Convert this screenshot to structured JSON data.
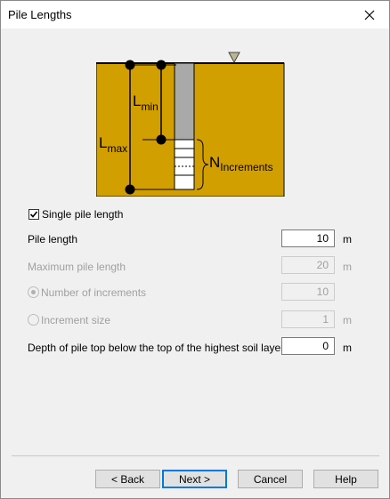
{
  "window": {
    "title": "Pile Lengths"
  },
  "diagram": {
    "l_max_main": "L",
    "l_max_sub": "max",
    "l_min_main": "L",
    "l_min_sub": "min",
    "n_incr_main": "N",
    "n_incr_sub": "Increments",
    "soil_color": "#d29f00"
  },
  "single_pile": {
    "label": "Single pile length",
    "checked": true
  },
  "pile_length": {
    "label": "Pile length",
    "value": "10",
    "unit": "m"
  },
  "max_pile_length": {
    "label": "Maximum pile length",
    "value": "20",
    "unit": "m"
  },
  "number_of_increments": {
    "label": "Number of increments",
    "value": "10",
    "selected": true
  },
  "increment_size": {
    "label": "Increment size",
    "value": "1",
    "unit": "m",
    "selected": false
  },
  "depth_pile_top": {
    "label": "Depth of pile top below the top of the highest soil layer",
    "value": "0",
    "unit": "m"
  },
  "buttons": {
    "back": "< Back",
    "next": "Next >",
    "cancel": "Cancel",
    "help": "Help"
  }
}
